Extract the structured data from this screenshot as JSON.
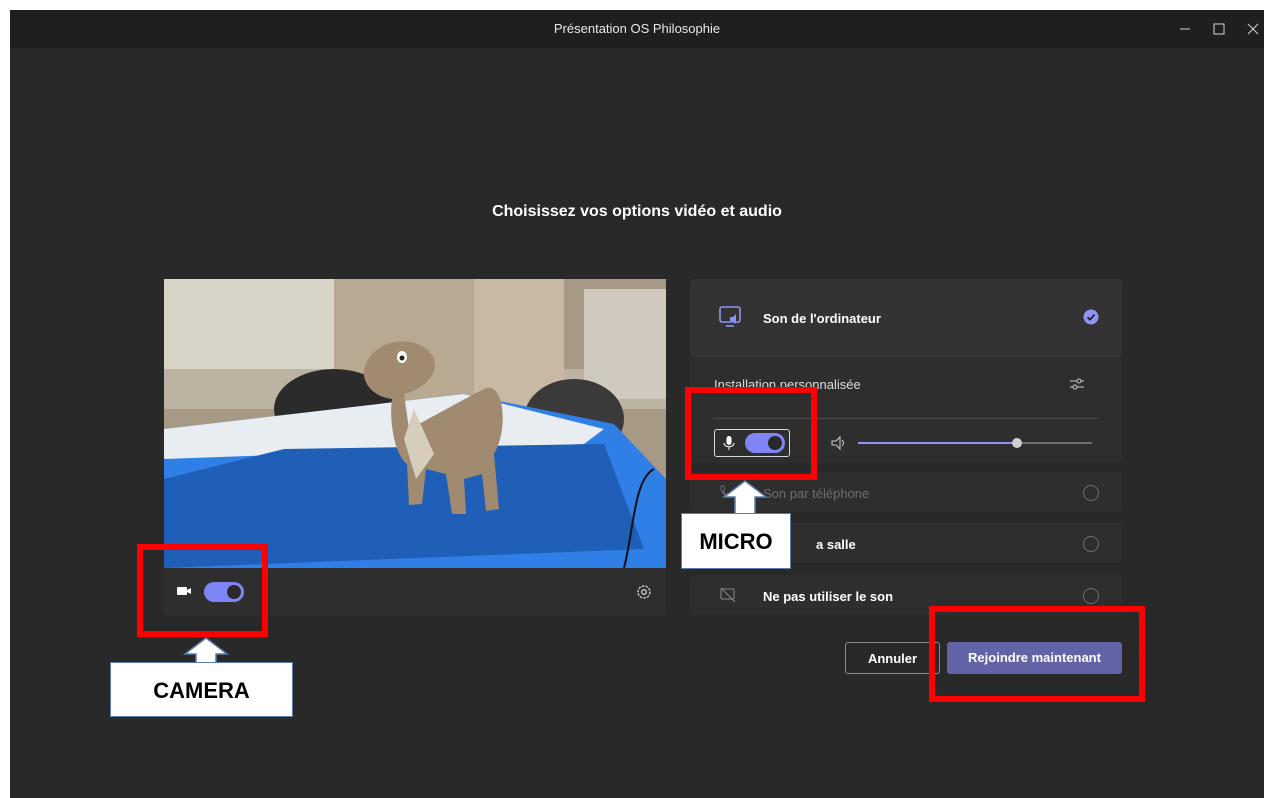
{
  "window": {
    "title": "Présentation OS Philosophie",
    "controls": [
      "minimize",
      "maximize",
      "close"
    ]
  },
  "heading": "Choisissez vos options vidéo et audio",
  "video": {
    "camera_toggle_on": true,
    "camera_icon": "video-camera-icon",
    "settings_icon": "gear-icon"
  },
  "audio_options": {
    "computer_audio": {
      "label": "Son de l'ordinateur",
      "selected": true,
      "icon": "computer-audio-icon"
    },
    "custom_setup": {
      "label": "Installation personnalisée",
      "mic_toggle_on": true,
      "speaker_volume": 0.68
    },
    "phone_audio": {
      "label": "Son par téléphone",
      "enabled": false
    },
    "room_audio": {
      "label": "a salle"
    },
    "no_audio": {
      "label": "Ne pas utiliser le son"
    }
  },
  "buttons": {
    "cancel": "Annuler",
    "join": "Rejoindre maintenant"
  },
  "annotations": {
    "camera": "CAMERA",
    "micro": "MICRO",
    "highlight_color": "#ff0000"
  },
  "colors": {
    "accent": "#6264a7",
    "toggle": "#7f85f5",
    "background": "#292929"
  }
}
